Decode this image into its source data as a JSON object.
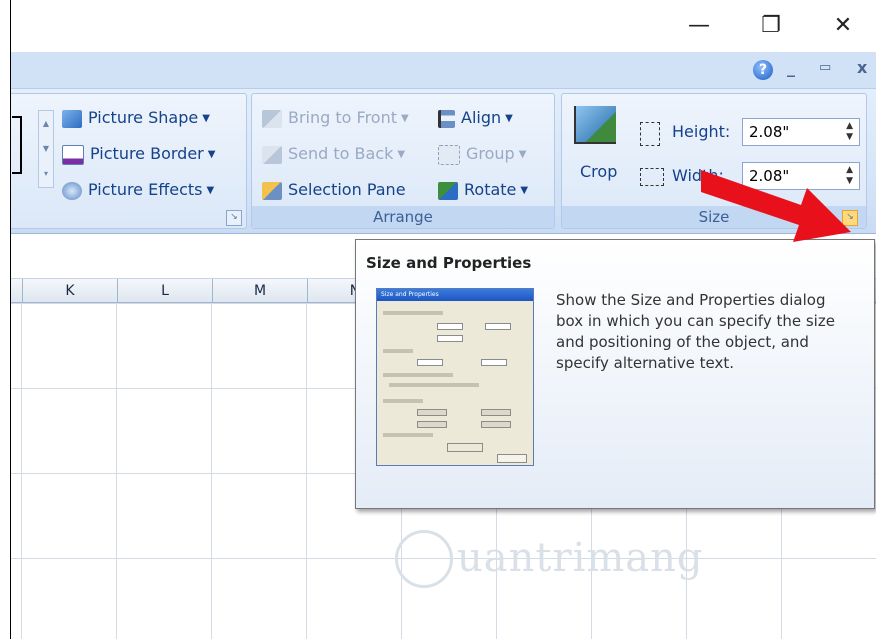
{
  "window": {
    "minimize": "—",
    "restore": "❐",
    "close": "✕"
  },
  "helprow": {
    "help": "?",
    "min": "_",
    "restore": "▭",
    "close": "x"
  },
  "picture_styles": {
    "shape": "Picture Shape",
    "border": "Picture Border",
    "effects": "Picture Effects"
  },
  "arrange": {
    "label": "Arrange",
    "bring_front": "Bring to Front",
    "send_back": "Send to Back",
    "selection_pane": "Selection Pane",
    "align": "Align",
    "group": "Group",
    "rotate": "Rotate"
  },
  "size": {
    "label": "Size",
    "crop": "Crop",
    "height_label": "Height:",
    "height_value": "2.08\"",
    "width_label": "Width:",
    "width_value": "2.08\""
  },
  "columns": [
    "K",
    "L",
    "M",
    "N"
  ],
  "tooltip": {
    "title": "Size and Properties",
    "text": "Show the Size and Properties dialog box in which you can specify the size and positioning of the object, and specify alternative text.",
    "thumb_title": "Size and Properties"
  },
  "watermark": "uantrimang",
  "colors": {
    "ribbon": "#d3e3f7",
    "arrow": "#e8111b",
    "text": "#15428b"
  }
}
